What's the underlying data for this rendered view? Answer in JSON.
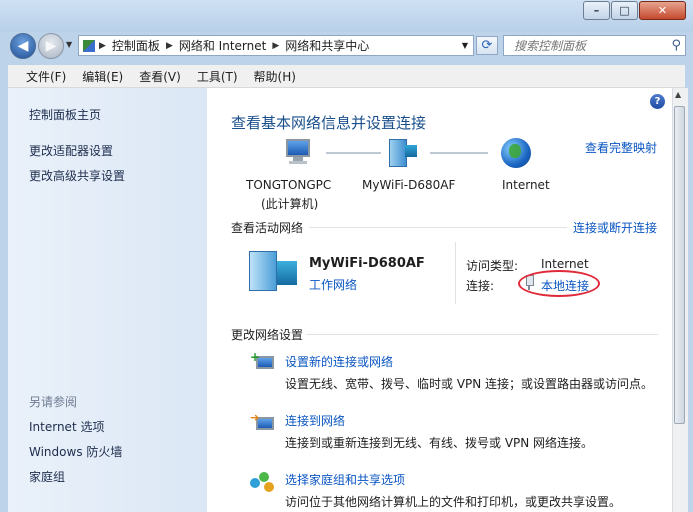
{
  "window": {
    "minimize": "–",
    "maximize": "□",
    "close": "✕"
  },
  "address": {
    "crumbs": [
      "控制面板",
      "网络和 Internet",
      "网络和共享中心"
    ],
    "search_placeholder": "搜索控制面板"
  },
  "menu": [
    "文件(F)",
    "编辑(E)",
    "查看(V)",
    "工具(T)",
    "帮助(H)"
  ],
  "sidebar": {
    "links": [
      "控制面板主页",
      "更改适配器设置",
      "更改高级共享设置"
    ],
    "see_also_title": "另请参阅",
    "see_also": [
      "Internet 选项",
      "Windows 防火墙",
      "家庭组"
    ]
  },
  "main": {
    "title": "查看基本网络信息并设置连接",
    "full_map_link": "查看完整映射",
    "map": {
      "pc_name": "TONGTONGPC",
      "pc_sub": "(此计算机)",
      "router": "MyWiFi-D680AF",
      "internet": "Internet"
    },
    "active_title": "查看活动网络",
    "connect_link": "连接或断开连接",
    "network_name": "MyWiFi-D680AF",
    "network_type": "工作网络",
    "access_label": "访问类型:",
    "access_value": "Internet",
    "conn_label": "连接:",
    "conn_value": "本地连接",
    "change_title": "更改网络设置",
    "tasks": [
      {
        "title": "设置新的连接或网络",
        "desc": "设置无线、宽带、拨号、临时或 VPN 连接；或设置路由器或访问点。"
      },
      {
        "title": "连接到网络",
        "desc": "连接到或重新连接到无线、有线、拨号或 VPN 网络连接。"
      },
      {
        "title": "选择家庭组和共享选项",
        "desc": "访问位于其他网络计算机上的文件和打印机，或更改共享设置。"
      }
    ]
  },
  "colors": {
    "link": "#0b56c2",
    "title": "#1a4f8c",
    "highlight": "#e02a3a"
  }
}
